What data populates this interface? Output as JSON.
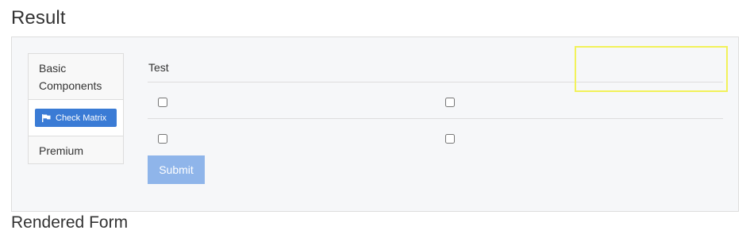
{
  "page": {
    "result_title": "Result",
    "rendered_title": "Rendered Form"
  },
  "sidebar": {
    "groups": [
      {
        "label": "Basic\nComponents"
      },
      {
        "label": "Premium"
      }
    ],
    "check_matrix_button": {
      "label": "Check Matrix",
      "icon": "flag-icon"
    }
  },
  "form": {
    "field_label": "Test",
    "checkbox_rows": [
      {
        "checkboxes": [
          {
            "checked": false
          },
          {
            "checked": false
          }
        ]
      },
      {
        "checkboxes": [
          {
            "checked": false
          },
          {
            "checked": false
          }
        ]
      }
    ],
    "submit_label": "Submit"
  },
  "colors": {
    "accent": "#3a7bd5",
    "submit": "#8fb5ea",
    "highlight": "#f2f25a",
    "panel_bg": "#f6f7f9"
  }
}
